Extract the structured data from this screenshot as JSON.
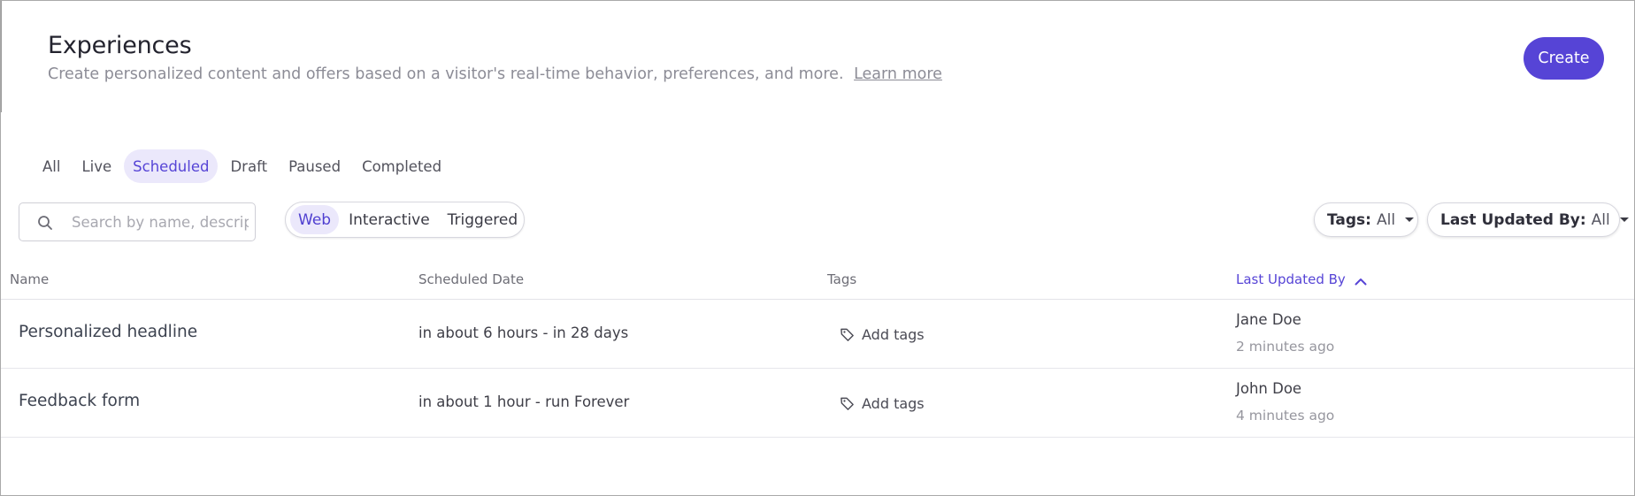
{
  "header": {
    "title": "Experiences",
    "subtitle": "Create personalized content and offers based on a visitor's real-time behavior, preferences, and more.",
    "learn_more": "Learn more",
    "create_label": "Create"
  },
  "status_tabs": [
    {
      "label": "All",
      "active": false
    },
    {
      "label": "Live",
      "active": false
    },
    {
      "label": "Scheduled",
      "active": true
    },
    {
      "label": "Draft",
      "active": false
    },
    {
      "label": "Paused",
      "active": false
    },
    {
      "label": "Completed",
      "active": false
    }
  ],
  "search": {
    "placeholder": "Search by name, description",
    "value": ""
  },
  "channel_filter": [
    {
      "label": "Web",
      "active": true
    },
    {
      "label": "Interactive",
      "active": false
    },
    {
      "label": "Triggered",
      "active": false
    }
  ],
  "filters": {
    "tags": {
      "key": "Tags:",
      "value": "All"
    },
    "last_updated_by": {
      "key": "Last Updated By:",
      "value": "All"
    }
  },
  "table": {
    "columns": [
      "Name",
      "Scheduled Date",
      "Tags",
      "Last Updated By"
    ],
    "sorted_column": "Last Updated By",
    "sort_direction": "ascending",
    "rows": [
      {
        "name": "Personalized headline",
        "scheduled_date": "in about 6 hours - in 28 days",
        "tags_action": "Add tags",
        "updated_by": "Jane Doe",
        "updated_ago": "2 minutes ago"
      },
      {
        "name": "Feedback form",
        "scheduled_date": "in about 1 hour - run Forever",
        "tags_action": "Add tags",
        "updated_by": "John Doe",
        "updated_ago": "4 minutes ago"
      }
    ]
  },
  "colors": {
    "accent": "#5644d6",
    "accent_soft": "#ebe8fb",
    "muted_text": "#8c8c96"
  },
  "icons": {
    "search": "search-icon",
    "tag": "tag-icon",
    "sort": "chevron-up-icon",
    "dropdown": "caret-down-icon"
  }
}
